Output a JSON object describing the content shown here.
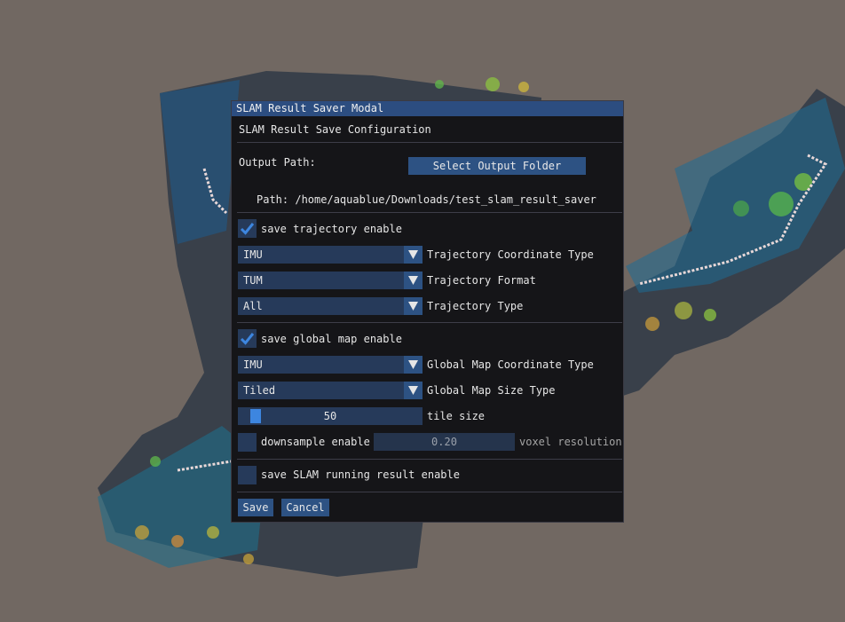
{
  "modal": {
    "title": "SLAM Result Saver Modal",
    "heading": "SLAM Result Save Configuration",
    "output_path_label": "Output Path:",
    "select_folder_button": "Select Output Folder",
    "path_text": "Path: /home/aquablue/Downloads/test_slam_result_saver"
  },
  "trajectory": {
    "enable_label": "save trajectory enable",
    "enabled": true,
    "coordinate_type": {
      "value": "IMU",
      "label": "Trajectory Coordinate Type"
    },
    "format": {
      "value": "TUM",
      "label": "Trajectory Format"
    },
    "type": {
      "value": "All",
      "label": "Trajectory Type"
    }
  },
  "global_map": {
    "enable_label": "save global map enable",
    "enabled": true,
    "coordinate_type": {
      "value": "IMU",
      "label": "Global Map Coordinate Type"
    },
    "size_type": {
      "value": "Tiled",
      "label": "Global Map Size Type"
    },
    "tile_size": {
      "value": "50",
      "label": "tile size"
    },
    "downsample": {
      "label": "downsample enable",
      "enabled": false,
      "value": "0.20",
      "value_label": "voxel resolution"
    }
  },
  "running_result": {
    "label": "save SLAM running result enable",
    "enabled": false
  },
  "footer": {
    "save_button": "Save",
    "cancel_button": "Cancel"
  },
  "colors": {
    "titlebar": "#2c4d80",
    "button": "#2d5283",
    "frame": "#263a5a",
    "checkmark": "#3d86e0",
    "background": "#716862"
  },
  "icons": {
    "check": "check-icon",
    "dropdown": "triangle-down-icon"
  }
}
